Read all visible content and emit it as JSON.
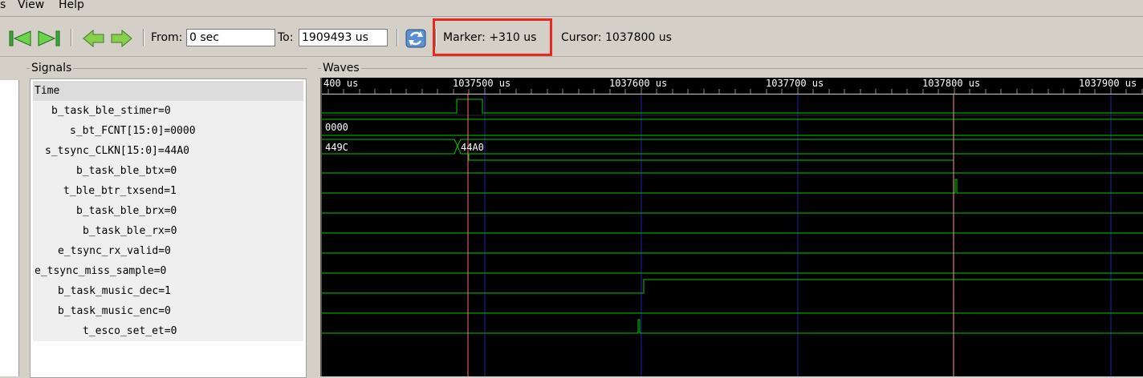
{
  "menu": {
    "item_partial": "s",
    "view": "View",
    "help": "Help"
  },
  "toolbar": {
    "from_label": "From:",
    "from_value": "0 sec",
    "to_label": "To:",
    "to_value": "1909493 us",
    "marker_text": "Marker: +310 us",
    "cursor_text": "Cursor: 1037800 us"
  },
  "signals": {
    "title": "Signals",
    "header": "Time",
    "rows": [
      "b_task_ble_stimer=0",
      "s_bt_FCNT[15:0]=0000",
      "s_tsync_CLKN[15:0]=44A0",
      "b_task_ble_btx=0",
      "t_ble_btr_txsend=1",
      "b_task_ble_brx=0",
      "b_task_ble_rx=0",
      "e_tsync_rx_valid=0",
      "e_tsync_miss_sample=0",
      "b_task_music_dec=1",
      "b_task_music_enc=0",
      "t_esco_set_et=0"
    ]
  },
  "waves": {
    "title": "Waves",
    "ruler_labels": [
      "400 us",
      "1037500 us",
      "1037600 us",
      "1037700 us",
      "1037800 us",
      "1037900 us"
    ],
    "bus_labels": {
      "fcnt": "0000",
      "clkn_before": "449C",
      "clkn_after": "44A0"
    }
  },
  "colors": {
    "signal": "#00c800",
    "marker": "#ff7070",
    "grid": "#1a1aa0",
    "highlight": "#e8281e"
  }
}
